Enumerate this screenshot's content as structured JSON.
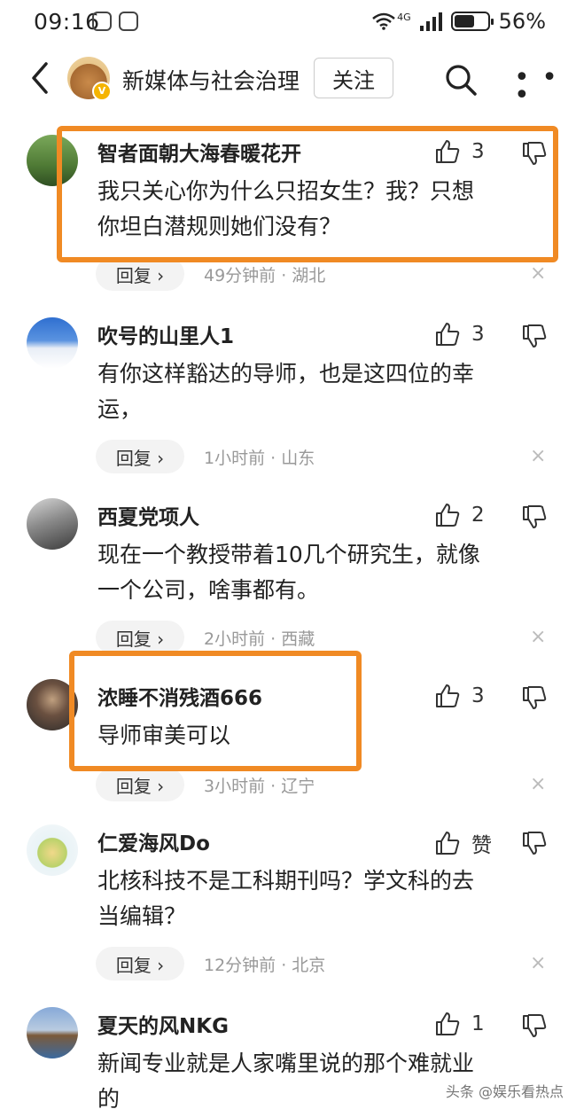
{
  "status": {
    "time": "09:16",
    "network": "4G",
    "battery": "56%"
  },
  "header": {
    "back_icon": "chevron-left-icon",
    "channel_name": "新媒体与社会治理",
    "follow_label": "关注",
    "search_icon": "search-icon",
    "more_icon": "more-icon"
  },
  "comments": [
    {
      "user": "智者面朝大海春暖花开",
      "likes": "3",
      "lines": [
        "我只关心你为什么只招女生？我？只想",
        "你坦白潜规则她们没有？"
      ],
      "reply": "回复 ›",
      "meta": "49分钟前 · 湖北",
      "highlighted": true
    },
    {
      "user": "吹号的山里人1",
      "likes": "3",
      "lines": [
        "有你这样豁达的导师，也是这四位的幸",
        "运，"
      ],
      "reply": "回复 ›",
      "meta": "1小时前 · 山东",
      "highlighted": false
    },
    {
      "user": "西夏党项人",
      "likes": "2",
      "lines": [
        "现在一个教授带着10几个研究生，就像",
        "一个公司，啥事都有。"
      ],
      "reply": "回复 ›",
      "meta": "2小时前 · 西藏",
      "highlighted": false
    },
    {
      "user": "浓睡不消残酒666",
      "likes": "3",
      "lines": [
        "导师审美可以"
      ],
      "reply": "回复 ›",
      "meta": "3小时前 · 辽宁",
      "highlighted": true
    },
    {
      "user": "仁爱海风Do",
      "likes": "赞",
      "lines": [
        "北核科技不是工科期刊吗？学文科的去",
        "当编辑？"
      ],
      "reply": "回复 ›",
      "meta": "12分钟前 · 北京",
      "highlighted": false
    },
    {
      "user": "夏天的风NKG",
      "likes": "1",
      "lines": [
        "新闻专业就是人家嘴里说的那个难就业",
        "的"
      ],
      "reply": "",
      "meta": "",
      "highlighted": false
    }
  ],
  "close_symbol": "×",
  "watermark": "头条 @娱乐看热点",
  "colors": {
    "highlight": "#f08a24",
    "reply_bg": "#f3f3f3",
    "meta_text": "#999999"
  }
}
